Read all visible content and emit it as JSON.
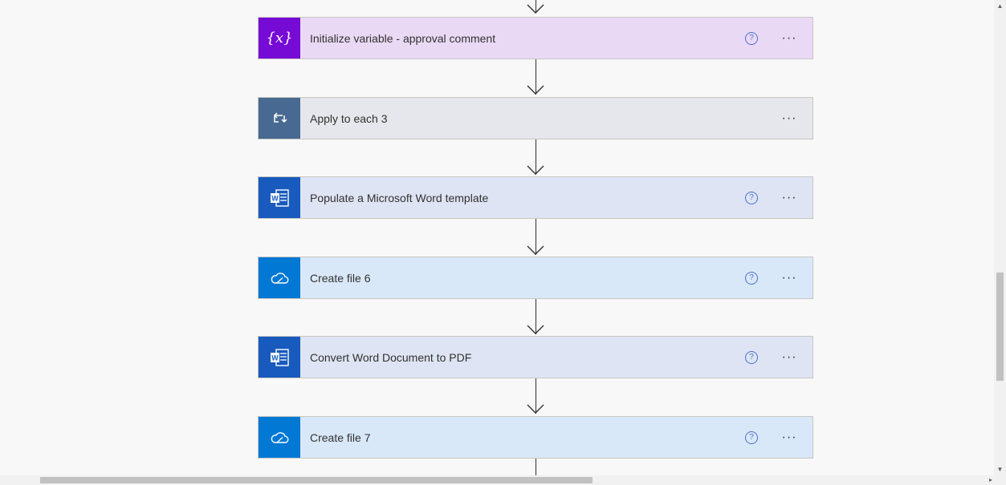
{
  "flow": {
    "steps": [
      {
        "title": "Initialize variable - approval comment",
        "icon": "variable-icon",
        "kind": "variable",
        "has_help": true
      },
      {
        "title": "Apply to each 3",
        "icon": "loop-icon",
        "kind": "control",
        "has_help": false
      },
      {
        "title": "Populate a Microsoft Word template",
        "icon": "word-icon",
        "kind": "word",
        "has_help": true
      },
      {
        "title": "Create file 6",
        "icon": "onedrive-icon",
        "kind": "onedrive",
        "has_help": true
      },
      {
        "title": "Convert Word Document to PDF",
        "icon": "word-icon",
        "kind": "word",
        "has_help": true
      },
      {
        "title": "Create file 7",
        "icon": "onedrive-icon",
        "kind": "onedrive",
        "has_help": true
      }
    ],
    "help_glyph": "?",
    "more_glyph": "···",
    "variable_glyph": "{x}"
  },
  "colors": {
    "variable": "#770bd6",
    "control": "#486991",
    "word": "#185abd",
    "onedrive": "#0078d4",
    "help": "#4a6fd1"
  },
  "scrollbars": {
    "up_glyph": "▲",
    "down_glyph": "▼",
    "right_glyph": "▸"
  }
}
